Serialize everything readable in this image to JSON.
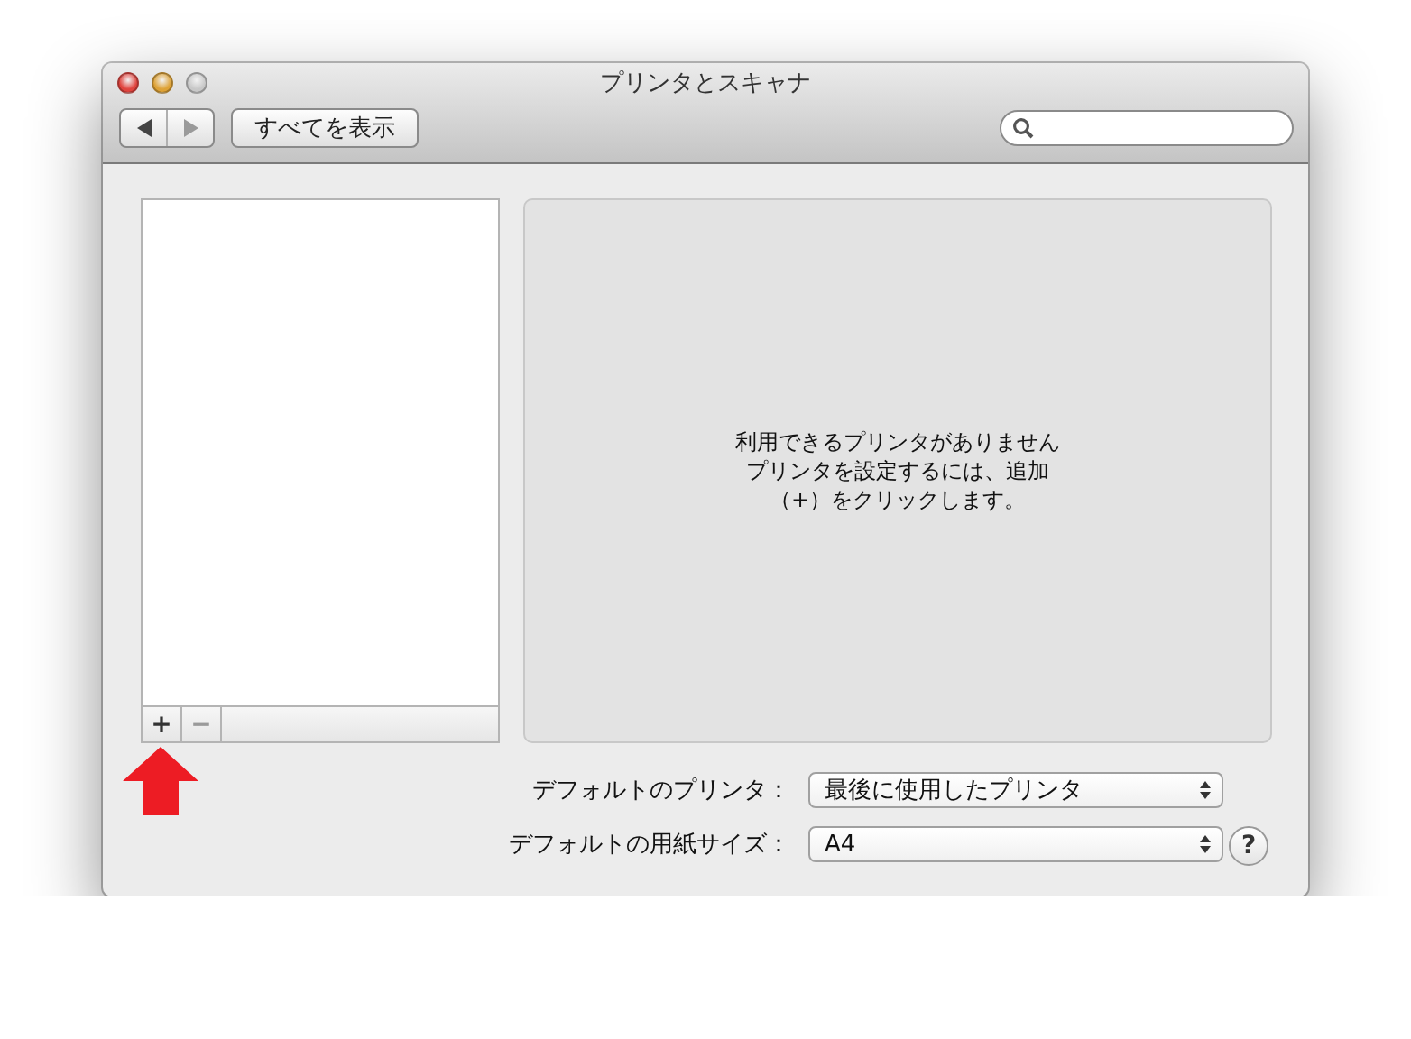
{
  "window": {
    "title": "プリンタとスキャナ"
  },
  "toolbar": {
    "nav_buttons": [
      {
        "kind": "back",
        "disabled": false
      },
      {
        "kind": "forward",
        "disabled": true
      }
    ],
    "show_all_button": "すべてを表示"
  },
  "list_buttons": [
    {
      "label": "+",
      "disabled": false
    },
    {
      "label": "−",
      "disabled": true
    }
  ],
  "message": [
    "利用できるプリンタがありません",
    "プリンタを設定するには、追加",
    "（+）をクリックします。"
  ],
  "settings": [
    {
      "label": "デフォルトのプリンタ：",
      "value": "最後に使用したプリンタ"
    },
    {
      "label": "デフォルトの用紙サイズ：",
      "value": "A4"
    }
  ],
  "help_button": "?",
  "annotation": {
    "kind": "arrow"
  }
}
